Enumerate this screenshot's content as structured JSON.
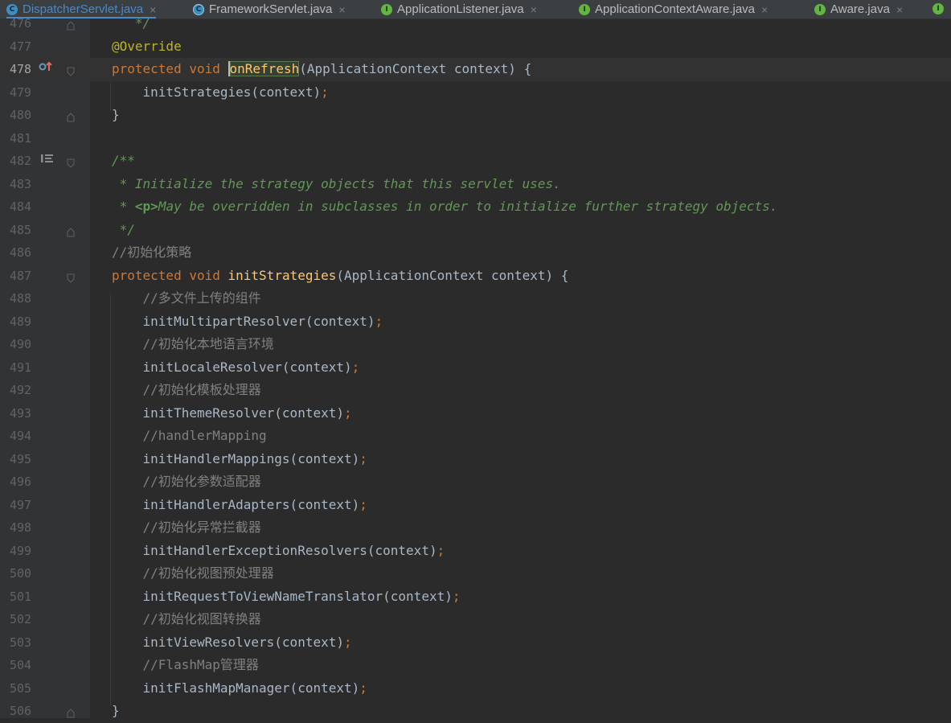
{
  "tabs": [
    {
      "label": "DispatcherServlet.java",
      "icon": "class-icon",
      "active": true
    },
    {
      "label": "FrameworkServlet.java",
      "icon": "abstract-class-icon",
      "active": false
    },
    {
      "label": "ApplicationListener.java",
      "icon": "interface-icon",
      "active": false
    },
    {
      "label": "ApplicationContextAware.java",
      "icon": "interface-icon",
      "active": false
    },
    {
      "label": "Aware.java",
      "icon": "interface-icon",
      "active": false
    }
  ],
  "tab_close_glyph": "×",
  "icon_letters": {
    "class": "C",
    "interface": "I"
  },
  "colors": {
    "background": "#2b2b2b",
    "keyword": "#cc7832",
    "annotation": "#bbb529",
    "method": "#ffc66d",
    "comment": "#808080",
    "javadoc": "#629755",
    "accent": "#4a88c7"
  },
  "editor": {
    "current_line": "478",
    "lines": [
      {
        "n": "476",
        "t": "   */"
      },
      {
        "n": "477",
        "t": "@Override"
      },
      {
        "n": "478",
        "t": "protected void onRefresh(ApplicationContext context) {"
      },
      {
        "n": "479",
        "t": "    initStrategies(context);"
      },
      {
        "n": "480",
        "t": "}"
      },
      {
        "n": "481",
        "t": ""
      },
      {
        "n": "482",
        "t": "/**"
      },
      {
        "n": "483",
        "t": " * Initialize the strategy objects that this servlet uses."
      },
      {
        "n": "484",
        "t": " * <p>May be overridden in subclasses in order to initialize further strategy objects."
      },
      {
        "n": "485",
        "t": " */"
      },
      {
        "n": "486",
        "t": "//初始化策略"
      },
      {
        "n": "487",
        "t": "protected void initStrategies(ApplicationContext context) {"
      },
      {
        "n": "488",
        "t": "    //多文件上传的组件"
      },
      {
        "n": "489",
        "t": "    initMultipartResolver(context);"
      },
      {
        "n": "490",
        "t": "    //初始化本地语言环境"
      },
      {
        "n": "491",
        "t": "    initLocaleResolver(context);"
      },
      {
        "n": "492",
        "t": "    //初始化模板处理器"
      },
      {
        "n": "493",
        "t": "    initThemeResolver(context);"
      },
      {
        "n": "494",
        "t": "    //handlerMapping"
      },
      {
        "n": "495",
        "t": "    initHandlerMappings(context);"
      },
      {
        "n": "496",
        "t": "    //初始化参数适配器"
      },
      {
        "n": "497",
        "t": "    initHandlerAdapters(context);"
      },
      {
        "n": "498",
        "t": "    //初始化异常拦截器"
      },
      {
        "n": "499",
        "t": "    initHandlerExceptionResolvers(context);"
      },
      {
        "n": "500",
        "t": "    //初始化视图预处理器"
      },
      {
        "n": "501",
        "t": "    initRequestToViewNameTranslator(context);"
      },
      {
        "n": "502",
        "t": "    //初始化视图转换器"
      },
      {
        "n": "503",
        "t": "    initViewResolvers(context);"
      },
      {
        "n": "504",
        "t": "    //FlashMap管理器"
      },
      {
        "n": "505",
        "t": "    initFlashMapManager(context);"
      },
      {
        "n": "506",
        "t": "}"
      }
    ]
  }
}
